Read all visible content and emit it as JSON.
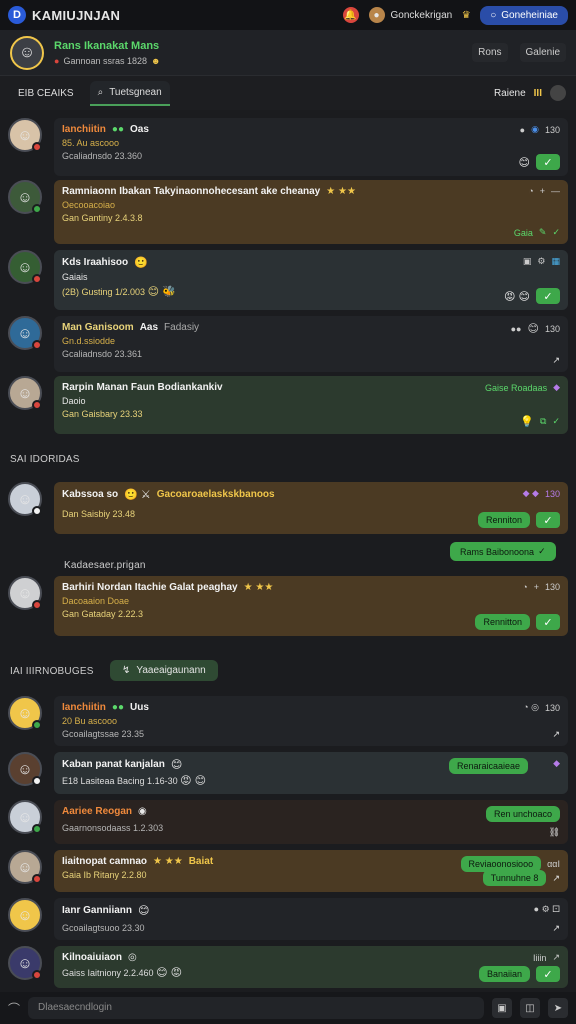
{
  "app": {
    "title": "KAMIUJNJAN",
    "logo": "D"
  },
  "topbar": {
    "user_name": "Gonckekrigan",
    "button_label": "Goneheiniae"
  },
  "chat": {
    "name": "Rans Ikanakat Mans",
    "status": "Gannoan ssras 1828"
  },
  "header_actions": [
    "Rons",
    "Galenie"
  ],
  "tabs": {
    "first": "EIB CEAIKS",
    "active": "Tuetsgnean",
    "right_label": "Raiene"
  },
  "messages": [
    {
      "name": "Ianchiitin",
      "extra": "Oas",
      "line2": "85. Au ascooo",
      "line3": "Gcaliadnsdo 23.360",
      "count": "130"
    },
    {
      "name": "Ramniaonn Ibakan Takyinaonnohecesant ake cheanay",
      "line2": "Oecooacoiao",
      "line3": "Gan Gantiny 2.4.3.8",
      "right_label": "Gaia"
    },
    {
      "name": "Kds Iraahisoo",
      "line2": "Gaiais",
      "line3": "(2B) Gusting 1/2.003"
    },
    {
      "name": "Man Ganisoom",
      "extra": "Aas",
      "extra2": "Fadasiy",
      "line2": "Gn.d.ssiodde",
      "line3": "Gcaliadnsdo 23.361",
      "count": "130"
    },
    {
      "name": "Rarpin Manan Faun Bodiankankiv",
      "line2": "Daoio",
      "line3": "Gan Gaisbary 23.33",
      "right_label": "Gaise Roadaas"
    },
    {
      "name": "Kabssoa so",
      "extra": "Gacoaroaelaskskbanoos",
      "line3": "Dan Saisbiy 23.48",
      "count": "130",
      "pill": "Renniton"
    },
    {
      "name": "Barhiri Nordan Itachie Galat peaghay",
      "line2": "Dacoaaion Doae",
      "line3": "Gan Gataday 2.22.3",
      "count": "130",
      "pill": "Rennitton"
    },
    {
      "name": "Ianchiitin",
      "extra": "Uus",
      "line2": "20 Bu ascooo",
      "line3": "Gcoailagtssae 23.35",
      "count": "130"
    },
    {
      "name": "Kaban panat kanjalan",
      "line3": "E18 Lasiteaa Bacing 1.16-30",
      "pill": "Renaraicaaieae"
    },
    {
      "name": "Aariee Reogan",
      "line3": "Gaarnonsodaass 1.2.303",
      "pill": "Ren unchoaco"
    },
    {
      "name": "Iiaitnopat camnao",
      "extra": "Baiat",
      "line3": "Gaia Ib Ritany 2.2.80",
      "pill": "Reviaoonosiooo",
      "pill2": "Tunnuhne 8"
    },
    {
      "name": "Ianr Ganniiann",
      "line3": "Gcoailagtsuoo 23.30"
    },
    {
      "name": "Kilnoaiuiaon",
      "line3": "Gaiss Iaitniony 2.2.460",
      "right_label": "Iiiin",
      "pill": "Banaiian"
    }
  ],
  "outgoing": {
    "label": "Rams Baibonoona"
  },
  "sections": {
    "s1": "SAI IDORIDAS",
    "s2": "Kadaesaer.prigan",
    "s3": "IAI IIIRNOBUGES",
    "s3_pill": "Yaaeaigaunann"
  },
  "composer": {
    "placeholder": "Dlaesaecndlogin"
  }
}
